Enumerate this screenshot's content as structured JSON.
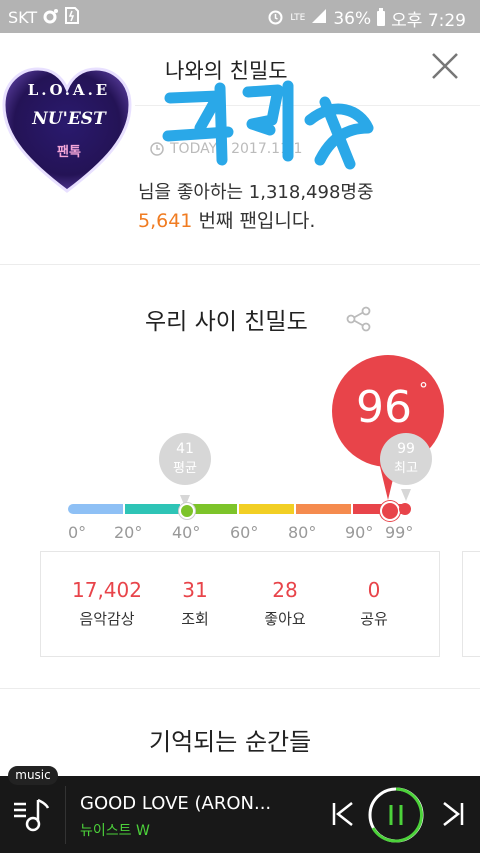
{
  "status_bar": {
    "carrier": "SKT",
    "network": "LTE",
    "battery": "36%",
    "time": "오후 7:29"
  },
  "header": {
    "title": "나와의 친밀도"
  },
  "sticker": {
    "line1": "L.O.A.E",
    "line2": "NU'EST",
    "line3": "팬톡"
  },
  "summary": {
    "date": "TODAY - 2017.11.1",
    "fans_text": "님을 좋아하는 1,318,498명중",
    "rank_number": "5,641",
    "rank_suffix": " 번째 팬입니다."
  },
  "intimacy": {
    "title": "우리 사이 친밀도",
    "score": "96",
    "degree": "°",
    "average_value": "41",
    "average_label": "평균",
    "max_value": "99",
    "max_label": "최고",
    "score_fraction": 0.96,
    "ticks": [
      "0°",
      "20°",
      "40°",
      "60°",
      "80°",
      "90°",
      "99°"
    ],
    "segment_colors": [
      "#8ec0f5",
      "#2ec4b6",
      "#7dc42a",
      "#f2cf24",
      "#f58b4e",
      "#e8444a"
    ]
  },
  "stats": [
    {
      "value": "17,402",
      "label": "음악감상"
    },
    {
      "value": "31",
      "label": "조회"
    },
    {
      "value": "28",
      "label": "좋아요"
    },
    {
      "value": "0",
      "label": "공유"
    }
  ],
  "moments": {
    "title": "기억되는 순간들"
  },
  "player": {
    "tag": "music",
    "song_title": "GOOD LOVE (ARON...",
    "artist": "뉴이스트 W"
  },
  "colors": {
    "accent_red": "#e8444a",
    "rank_orange": "#f07c22",
    "player_green": "#4cd23a"
  }
}
